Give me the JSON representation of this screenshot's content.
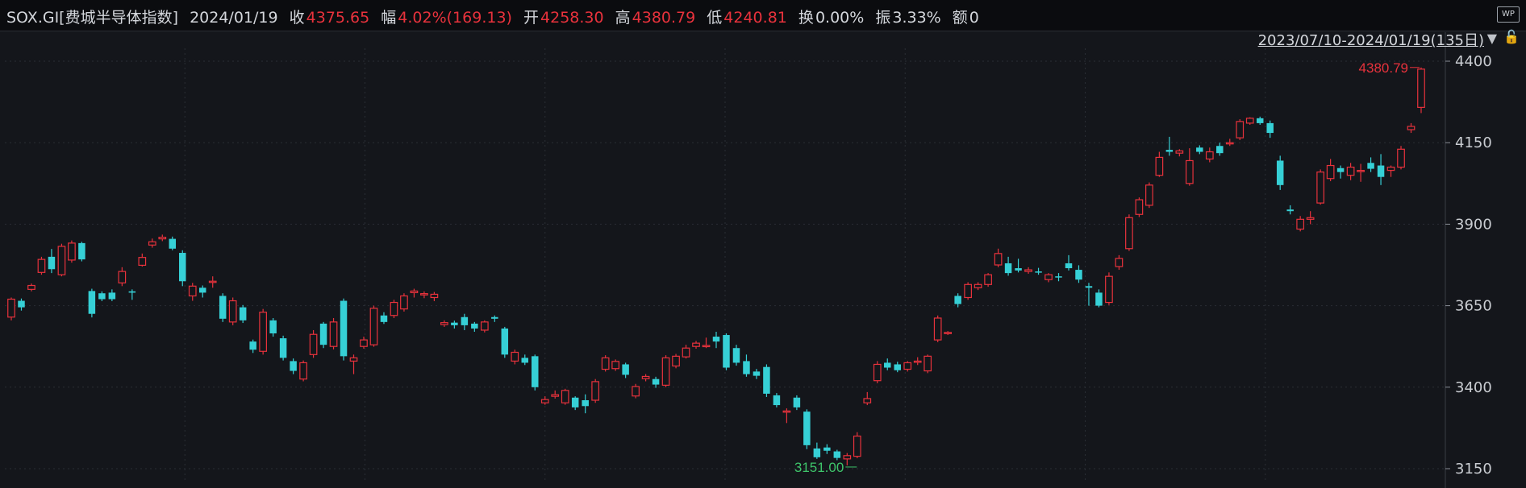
{
  "header": {
    "symbol": "SOX.GI[费城半导体指数]",
    "date": "2024/01/19",
    "close_label": "收",
    "close": "4375.65",
    "change_label": "幅",
    "change": "4.02%(169.13)",
    "open_label": "开",
    "open": "4258.30",
    "high_label": "高",
    "high": "4380.79",
    "low_label": "低",
    "low": "4240.81",
    "turnover_label": "换",
    "turnover": "0.00%",
    "amplitude_label": "振",
    "amplitude": "3.33%",
    "amount_label": "额",
    "amount": "0"
  },
  "date_range": "2023/07/10-2024/01/19(135日)",
  "wp_badge": "WP",
  "colors": {
    "up": "#e8323c",
    "down": "#36d0d6",
    "background": "#14161b",
    "grid": "#2a2e35"
  },
  "chart_data": {
    "type": "candlestick",
    "y_ticks": [
      "4400",
      "4150",
      "3900",
      "3650",
      "3400",
      "3150"
    ],
    "ylim": [
      3140,
      4410
    ],
    "max_label": "4380.79",
    "min_label": "3151.00",
    "candles": [
      [
        3615,
        3670,
        3605,
        3675
      ],
      [
        3665,
        3645,
        3635,
        3672
      ],
      [
        3700,
        3712,
        3694,
        3718
      ],
      [
        3752,
        3792,
        3745,
        3800
      ],
      [
        3800,
        3762,
        3750,
        3824
      ],
      [
        3745,
        3832,
        3740,
        3840
      ],
      [
        3790,
        3842,
        3782,
        3850
      ],
      [
        3842,
        3792,
        3786,
        3846
      ],
      [
        3695,
        3625,
        3614,
        3702
      ],
      [
        3688,
        3670,
        3664,
        3694
      ],
      [
        3690,
        3670,
        3664,
        3700
      ],
      [
        3720,
        3755,
        3710,
        3768
      ],
      [
        3694,
        3690,
        3668,
        3700
      ],
      [
        3774,
        3798,
        3770,
        3810
      ],
      [
        3836,
        3846,
        3828,
        3856
      ],
      [
        3855,
        3860,
        3848,
        3868
      ],
      [
        3855,
        3825,
        3820,
        3862
      ],
      [
        3812,
        3725,
        3710,
        3820
      ],
      [
        3680,
        3710,
        3665,
        3720
      ],
      [
        3705,
        3690,
        3675,
        3712
      ],
      [
        3725,
        3725,
        3705,
        3740
      ],
      [
        3680,
        3610,
        3600,
        3688
      ],
      [
        3600,
        3665,
        3590,
        3675
      ],
      [
        3645,
        3605,
        3597,
        3652
      ],
      [
        3540,
        3515,
        3505,
        3546
      ],
      [
        3510,
        3630,
        3500,
        3640
      ],
      [
        3605,
        3565,
        3555,
        3612
      ],
      [
        3550,
        3490,
        3482,
        3558
      ],
      [
        3480,
        3450,
        3440,
        3488
      ],
      [
        3425,
        3475,
        3418,
        3482
      ],
      [
        3500,
        3562,
        3490,
        3575
      ],
      [
        3595,
        3530,
        3520,
        3600
      ],
      [
        3525,
        3600,
        3516,
        3612
      ],
      [
        3665,
        3495,
        3482,
        3672
      ],
      [
        3480,
        3490,
        3440,
        3500
      ],
      [
        3525,
        3545,
        3518,
        3555
      ],
      [
        3530,
        3642,
        3524,
        3650
      ],
      [
        3620,
        3600,
        3594,
        3630
      ],
      [
        3620,
        3660,
        3612,
        3668
      ],
      [
        3640,
        3680,
        3632,
        3688
      ],
      [
        3690,
        3695,
        3675,
        3702
      ],
      [
        3683,
        3687,
        3673,
        3694
      ],
      [
        3675,
        3685,
        3664,
        3692
      ],
      [
        3592,
        3598,
        3585,
        3605
      ],
      [
        3598,
        3590,
        3580,
        3604
      ],
      [
        3615,
        3590,
        3575,
        3625
      ],
      [
        3595,
        3580,
        3570,
        3600
      ],
      [
        3575,
        3600,
        3568,
        3605
      ],
      [
        3615,
        3610,
        3600,
        3620
      ],
      [
        3580,
        3500,
        3490,
        3585
      ],
      [
        3480,
        3507,
        3470,
        3515
      ],
      [
        3490,
        3475,
        3468,
        3500
      ],
      [
        3495,
        3400,
        3390,
        3500
      ],
      [
        3352,
        3362,
        3346,
        3372
      ],
      [
        3372,
        3377,
        3365,
        3390
      ],
      [
        3352,
        3390,
        3346,
        3395
      ],
      [
        3368,
        3338,
        3330,
        3372
      ],
      [
        3360,
        3342,
        3320,
        3378
      ],
      [
        3360,
        3417,
        3352,
        3425
      ],
      [
        3455,
        3490,
        3448,
        3498
      ],
      [
        3457,
        3479,
        3450,
        3485
      ],
      [
        3470,
        3438,
        3428,
        3475
      ],
      [
        3373,
        3402,
        3366,
        3410
      ],
      [
        3426,
        3433,
        3418,
        3440
      ],
      [
        3425,
        3408,
        3398,
        3432
      ],
      [
        3406,
        3490,
        3400,
        3498
      ],
      [
        3465,
        3495,
        3458,
        3502
      ],
      [
        3493,
        3520,
        3488,
        3530
      ],
      [
        3525,
        3535,
        3518,
        3542
      ],
      [
        3528,
        3528,
        3520,
        3552
      ],
      [
        3555,
        3540,
        3520,
        3570
      ],
      [
        3560,
        3460,
        3452,
        3565
      ],
      [
        3520,
        3475,
        3466,
        3530
      ],
      [
        3480,
        3440,
        3432,
        3500
      ],
      [
        3448,
        3435,
        3425,
        3456
      ],
      [
        3462,
        3380,
        3370,
        3470
      ],
      [
        3375,
        3345,
        3338,
        3382
      ],
      [
        3325,
        3327,
        3290,
        3335
      ],
      [
        3368,
        3338,
        3330,
        3375
      ],
      [
        3325,
        3222,
        3210,
        3332
      ],
      [
        3212,
        3185,
        3180,
        3230
      ],
      [
        3215,
        3205,
        3195,
        3225
      ],
      [
        3203,
        3183,
        3176,
        3208
      ],
      [
        3180,
        3190,
        3160,
        3198
      ],
      [
        3188,
        3250,
        3182,
        3262
      ],
      [
        3352,
        3365,
        3345,
        3385
      ],
      [
        3420,
        3470,
        3412,
        3480
      ],
      [
        3475,
        3460,
        3452,
        3488
      ],
      [
        3470,
        3452,
        3446,
        3478
      ],
      [
        3455,
        3475,
        3448,
        3480
      ],
      [
        3478,
        3480,
        3468,
        3492
      ],
      [
        3450,
        3495,
        3443,
        3500
      ],
      [
        3545,
        3612,
        3538,
        3620
      ],
      [
        3565,
        3568,
        3560,
        3572
      ],
      [
        3680,
        3655,
        3645,
        3688
      ],
      [
        3675,
        3715,
        3668,
        3722
      ],
      [
        3705,
        3715,
        3698,
        3722
      ],
      [
        3715,
        3745,
        3708,
        3750
      ],
      [
        3775,
        3810,
        3768,
        3825
      ],
      [
        3780,
        3750,
        3742,
        3800
      ],
      [
        3765,
        3758,
        3752,
        3794
      ],
      [
        3755,
        3760,
        3748,
        3768
      ],
      [
        3755,
        3752,
        3745,
        3766
      ],
      [
        3730,
        3745,
        3722,
        3750
      ],
      [
        3740,
        3738,
        3725,
        3750
      ],
      [
        3780,
        3765,
        3758,
        3805
      ],
      [
        3760,
        3730,
        3720,
        3774
      ],
      [
        3710,
        3705,
        3650,
        3720
      ],
      [
        3690,
        3650,
        3645,
        3700
      ],
      [
        3660,
        3740,
        3652,
        3752
      ],
      [
        3770,
        3795,
        3760,
        3805
      ],
      [
        3825,
        3920,
        3818,
        3930
      ],
      [
        3930,
        3975,
        3922,
        3982
      ],
      [
        3958,
        4020,
        3950,
        4028
      ],
      [
        4050,
        4105,
        4045,
        4122
      ],
      [
        4128,
        4122,
        4110,
        4168
      ],
      [
        4118,
        4125,
        4108,
        4130
      ],
      [
        4025,
        4095,
        4018,
        4133
      ],
      [
        4135,
        4122,
        4115,
        4142
      ],
      [
        4100,
        4122,
        4090,
        4135
      ],
      [
        4140,
        4118,
        4110,
        4150
      ],
      [
        4150,
        4150,
        4140,
        4162
      ],
      [
        4165,
        4215,
        4158,
        4222
      ],
      [
        4210,
        4225,
        4205,
        4228
      ],
      [
        4225,
        4210,
        4205,
        4230
      ],
      [
        4210,
        4180,
        4165,
        4218
      ],
      [
        4095,
        4020,
        4005,
        4110
      ],
      [
        3945,
        3940,
        3930,
        3958
      ],
      [
        3885,
        3915,
        3878,
        3925
      ],
      [
        3915,
        3920,
        3900,
        3940
      ],
      [
        3965,
        4060,
        3960,
        4068
      ],
      [
        4040,
        4080,
        4032,
        4100
      ],
      [
        4072,
        4060,
        4040,
        4080
      ],
      [
        4050,
        4075,
        4035,
        4088
      ],
      [
        4065,
        4065,
        4030,
        4085
      ],
      [
        4088,
        4070,
        4060,
        4105
      ],
      [
        4080,
        4045,
        4020,
        4115
      ],
      [
        4065,
        4075,
        4045,
        4080
      ],
      [
        4075,
        4130,
        4068,
        4140
      ],
      [
        4190,
        4200,
        4180,
        4210
      ],
      [
        4258.3,
        4375.65,
        4240.81,
        4380.79
      ]
    ]
  }
}
